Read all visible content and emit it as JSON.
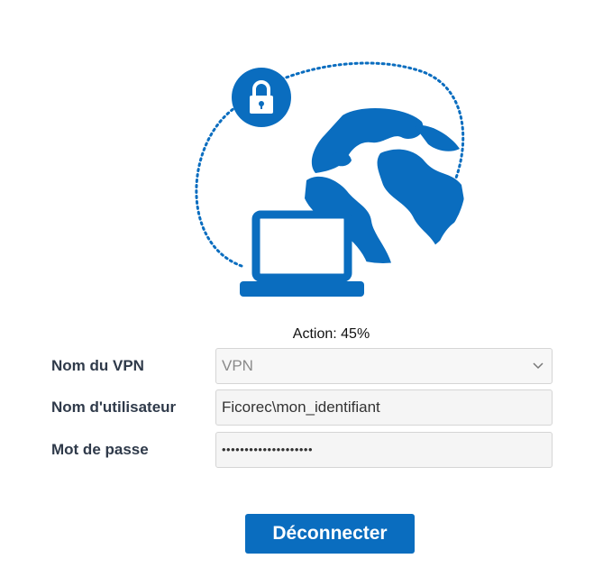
{
  "status": {
    "text": "Action: 45%",
    "progress_percent": 45
  },
  "form": {
    "vpn_name": {
      "label": "Nom du VPN",
      "value": "VPN"
    },
    "username": {
      "label": "Nom d'utilisateur",
      "value": "Ficorec\\mon_identifiant"
    },
    "password": {
      "label": "Mot de passe",
      "value": "••••••••••••••••••••"
    }
  },
  "actions": {
    "disconnect_label": "Déconnecter"
  },
  "icons": {
    "illustration": [
      "lock-icon",
      "globe-icon",
      "laptop-icon"
    ],
    "select_arrow": "chevron-down-icon"
  },
  "colors": {
    "accent": "#0a6dbf",
    "label": "#2f3a4a",
    "field_bg": "#f5f5f5"
  }
}
